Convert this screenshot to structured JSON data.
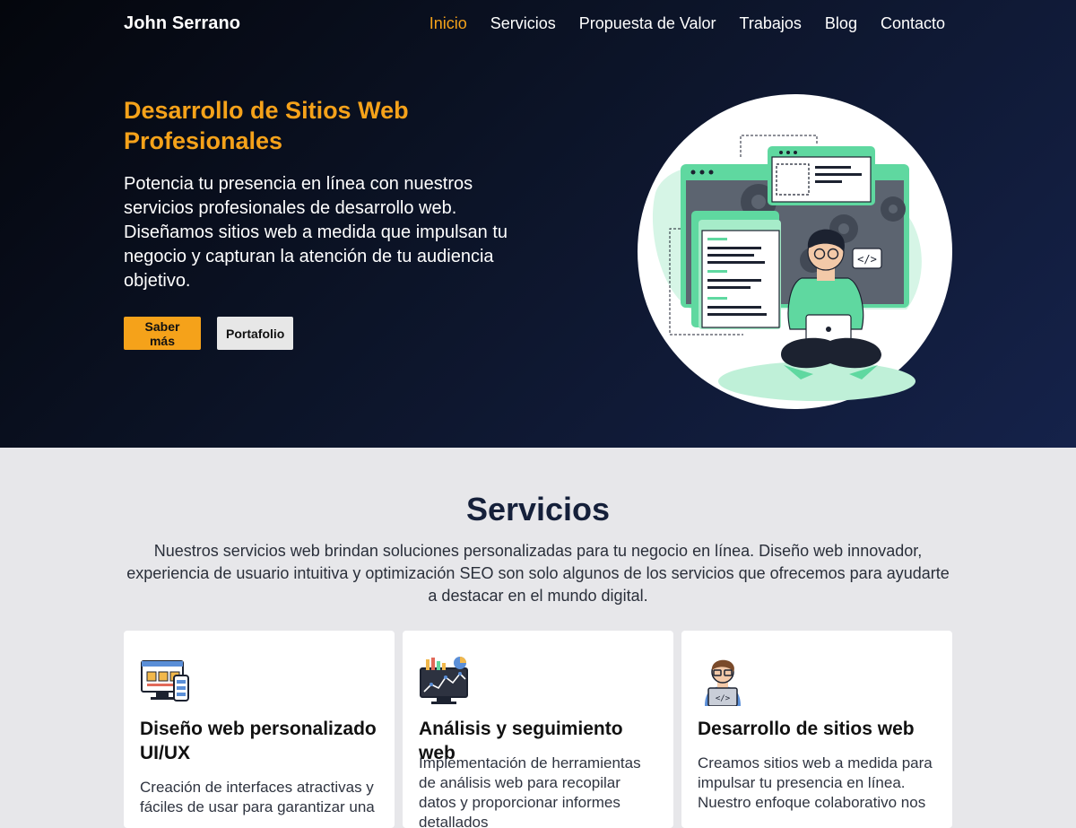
{
  "header": {
    "brand": "John Serrano",
    "nav": [
      "Inicio",
      "Servicios",
      "Propuesta de Valor",
      "Trabajos",
      "Blog",
      "Contacto"
    ],
    "active": "Inicio"
  },
  "hero": {
    "title": "Desarrollo de Sitios Web Profesionales",
    "text": "Potencia tu presencia en línea con nuestros servicios profesionales de desarrollo web. Diseñamos sitios web a medida que impulsan tu negocio y capturan la atención de tu audiencia objetivo.",
    "primary_button": "Saber más",
    "secondary_button": "Portafolio",
    "illustration_icon": "developer-laptop-illustration"
  },
  "services": {
    "title": "Servicios",
    "description": "Nuestros servicios web brindan soluciones personalizadas para tu negocio en línea. Diseño web innovador, experiencia de usuario intuitiva y optimización SEO son solo algunos de los servicios que ofrecemos para ayudarte a destacar en el mundo digital.",
    "cards": [
      {
        "icon": "ui-ux-design-icon",
        "title": "Diseño web personalizado UI/UX",
        "text": "Creación de interfaces atractivas y fáciles de usar para garantizar una"
      },
      {
        "icon": "analytics-chart-icon",
        "title": "Análisis y seguimiento web",
        "text": "Implementación de herramientas de análisis web para recopilar datos y proporcionar informes detallados"
      },
      {
        "icon": "developer-icon",
        "title": "Desarrollo de sitios web",
        "text": "Creamos sitios web a medida para impulsar tu presencia en línea. Nuestro enfoque colaborativo nos"
      }
    ]
  },
  "colors": {
    "accent": "#f5a21a",
    "hero_bg": "#0c1428",
    "mint": "#5fd8a0",
    "section_bg": "#e7e7ea"
  }
}
